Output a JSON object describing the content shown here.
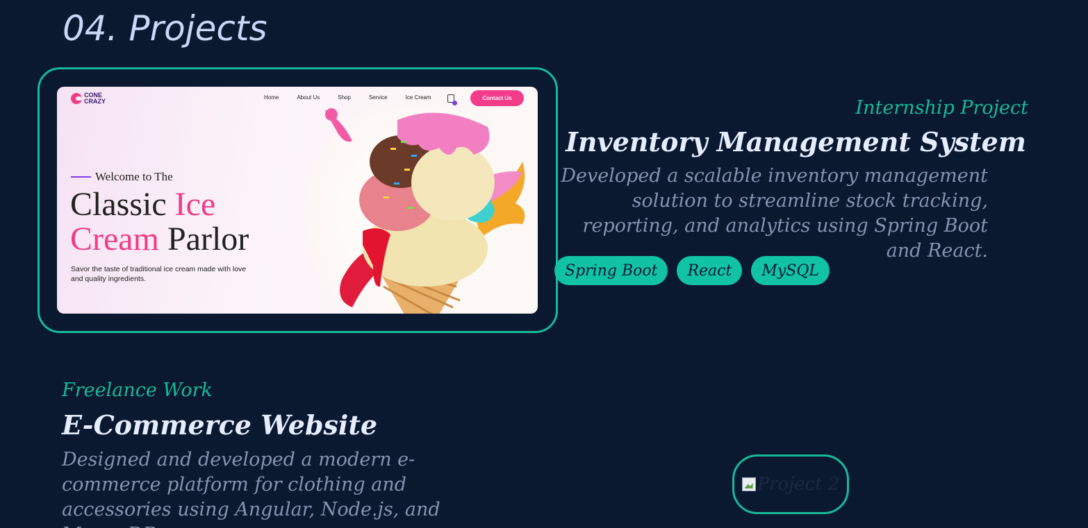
{
  "section": {
    "title": "04. Projects"
  },
  "project1": {
    "overline": "Internship Project",
    "title": "Inventory Management System",
    "description": "Developed a scalable inventory management solution to streamline stock tracking, reporting, and analytics using Spring Boot and React.",
    "tags": [
      "Spring Boot",
      "React",
      "MySQL"
    ],
    "screenshot": {
      "logo": "CONE CRAZY",
      "nav": [
        "Home",
        "About Us",
        "Shop",
        "Service",
        "Ice Cream"
      ],
      "cta": "Contact Us",
      "welcome": "Welcome to The",
      "headline_1a": "Classic ",
      "headline_1b": "Ice",
      "headline_2a": "Cream",
      "headline_2b": " Parlor",
      "subtitle": "Savor the taste of traditional ice cream made with love and quality ingredients."
    }
  },
  "project2": {
    "overline": "Freelance Work",
    "title": "E-Commerce Website",
    "description": "Designed and developed a modern e-commerce platform for clothing and accessories using Angular, Node.js, and MongoDB.",
    "image_alt": "Project 2"
  },
  "colors": {
    "background": "#0b1930",
    "accent": "#17b99a",
    "heading": "#e6edff",
    "muted": "#8892b0",
    "brand_pink": "#f23a87"
  }
}
